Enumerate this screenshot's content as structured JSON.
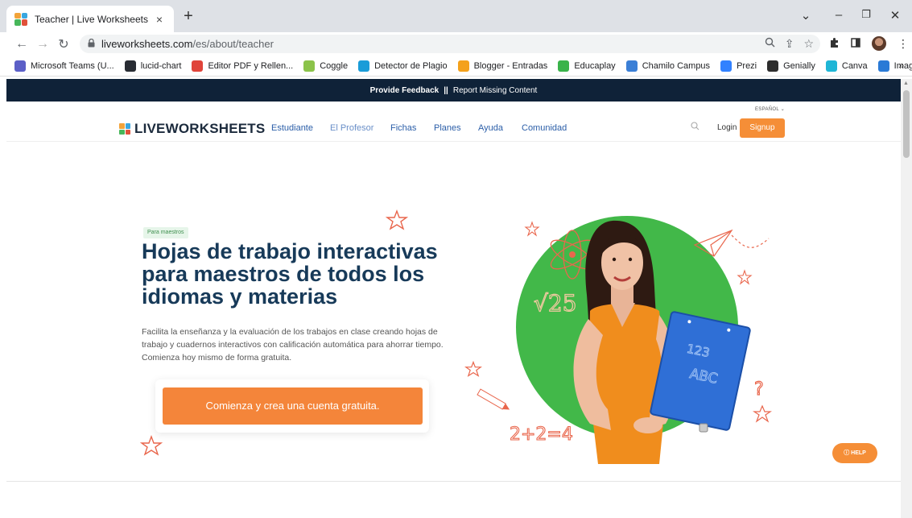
{
  "browser": {
    "tab_title": "Teacher | Live Worksheets",
    "tab_close": "×",
    "new_tab": "+",
    "url_domain": "liveworksheets.com",
    "url_path": "/es/about/teacher",
    "bookmarks": [
      {
        "label": "Microsoft Teams (U...",
        "icon": "teams-icon",
        "color": "#5b5fc7"
      },
      {
        "label": "lucid-chart",
        "icon": "lucid-icon",
        "color": "#282c33"
      },
      {
        "label": "Editor PDF y Rellen...",
        "icon": "pdf-icon",
        "color": "#e0443a"
      },
      {
        "label": "Coggle",
        "icon": "coggle-icon",
        "color": "#8bc34a"
      },
      {
        "label": "Detector de Plagio",
        "icon": "plagio-icon",
        "color": "#1a9cd8"
      },
      {
        "label": "Blogger - Entradas",
        "icon": "blogger-icon",
        "color": "#f4a11b"
      },
      {
        "label": "Educaplay",
        "icon": "educaplay-icon",
        "color": "#3ab34a"
      },
      {
        "label": "Chamilo Campus",
        "icon": "chamilo-icon",
        "color": "#3b7fd6"
      },
      {
        "label": "Prezi",
        "icon": "prezi-icon",
        "color": "#3181ff"
      },
      {
        "label": "Genially",
        "icon": "genially-icon",
        "color": "#2d2d2d"
      },
      {
        "label": "Canva",
        "icon": "canva-icon",
        "color": "#1fb6d6"
      },
      {
        "label": "Imagenes_link",
        "icon": "ibb-icon",
        "color": "#2a7ad6"
      }
    ],
    "bookmarks_more": "»"
  },
  "site": {
    "feedback": {
      "provide": "Provide Feedback",
      "sep": "||",
      "report": "Report Missing Content"
    },
    "language": "ESPAÑOL",
    "logo": "LIVEWORKSHEETS",
    "nav": {
      "student": "Estudiante",
      "teacher": "El Profesor",
      "sheets": "Fichas",
      "plans": "Planes",
      "help": "Ayuda",
      "community": "Comunidad"
    },
    "login": "Login",
    "signup": "Signup"
  },
  "hero": {
    "badge": "Para maestros",
    "title": "Hojas de trabajo interactivas para maestros de todos los idiomas y materias",
    "description": "Facilita la enseñanza y la evaluación de los trabajos en clase creando hojas de trabajo y cuadernos interactivos con calificación automática para ahorrar tiempo. Comienza hoy mismo de forma gratuita.",
    "cta": "Comienza y crea una cuenta gratuita."
  },
  "illustration": {
    "sqrt_text": "√25",
    "math_text": "2+2=4",
    "folder_text_1": "123",
    "folder_text_2": "ABC",
    "question_mark": "?"
  },
  "help_button": "HELP",
  "colors": {
    "accent_orange": "#f58e37",
    "navy": "#0f2238",
    "title_blue": "#173a59",
    "green_circle": "#42b849",
    "doodle": "#e9674d"
  }
}
